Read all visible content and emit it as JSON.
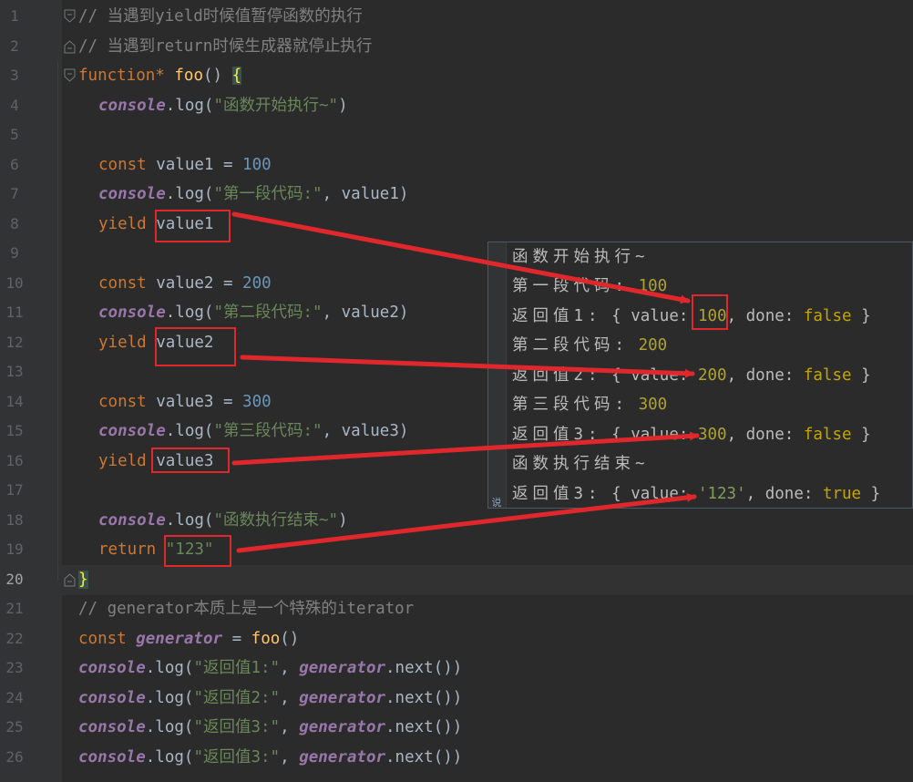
{
  "editor": {
    "current_line": 20,
    "line_numbers": [
      "1",
      "2",
      "3",
      "4",
      "5",
      "6",
      "7",
      "8",
      "9",
      "10",
      "11",
      "12",
      "13",
      "14",
      "15",
      "16",
      "17",
      "18",
      "19",
      "20",
      "21",
      "22",
      "23",
      "24",
      "25",
      "26"
    ],
    "lines": {
      "l1": "// 当遇到yield时候值暂停函数的执行",
      "l2": "// 当遇到return时候生成器就停止执行",
      "l3_kw": "function",
      "l3_star": "* ",
      "l3_fn": "foo",
      "l3_rest": "() ",
      "l3_brace": "{",
      "console": "console",
      "log_open": ".log(",
      "l4_str": "\"函数开始执行~\"",
      "close": ")",
      "const": "const ",
      "l6_var": "value1 = ",
      "l6_num": "100",
      "l7_str": "\"第一段代码:\"",
      "l7_rest": ", value1)",
      "yield": "yield ",
      "l8_val": "value1",
      "l10_var": "value2 = ",
      "l10_num": "200",
      "l11_str": "\"第二段代码:\"",
      "l11_rest": ", value2)",
      "l12_val": "value2",
      "l14_var": "value3 = ",
      "l14_num": "300",
      "l15_str": "\"第三段代码:\"",
      "l15_rest": ", value3)",
      "l16_val": "value3",
      "l18_str": "\"函数执行结束~\"",
      "return": "return ",
      "l19_str": "\"123\"",
      "l20_brace": "}",
      "l21": "// generator本质上是一个特殊的iterator",
      "l22_const": "const ",
      "l22_gen": "generator",
      "l22_eq": " = ",
      "l22_fn": "foo",
      "l22_rest": "()",
      "l23_str": "\"返回值1:\"",
      "l24_str": "\"返回值2:\"",
      "l25_str": "\"返回值3:\"",
      "l26_str": "\"返回值3:\"",
      "comma": ", ",
      "generator": "generator",
      "next": ".next())"
    }
  },
  "console_output": {
    "c1": "函数开始执行~",
    "c2_label": "第一段代码:",
    "c2_num": "100",
    "c3_label": "返回值1:",
    "c3_open": "{ value: ",
    "c3_val": "100",
    "c3_mid": ", done: ",
    "c3_done": "false",
    "c3_end": " }",
    "c4_label": "第二段代码:",
    "c4_num": "200",
    "c5_label": "返回值2:",
    "c5_open": "{ value: ",
    "c5_val": "200",
    "c5_mid": ", done: ",
    "c5_done": "false",
    "c5_end": " }",
    "c6_label": "第三段代码:",
    "c6_num": "300",
    "c7_label": "返回值3:",
    "c7_open": "{ value: ",
    "c7_val": "300",
    "c7_mid": ", done: ",
    "c7_done": "false",
    "c7_end": " }",
    "c8": "函数执行结束~",
    "c9_label": "返回值3:",
    "c9_open": "{ value: ",
    "c9_val": "'123'",
    "c9_mid": ", done: ",
    "c9_done": "true",
    "c9_end": " }",
    "side_icon": "说"
  },
  "colors": {
    "background": "#2b2b2b",
    "annotation_red": "#e0282c",
    "keyword": "#cc7832",
    "function": "#ffc66d",
    "string": "#6a8759",
    "number": "#6897bb"
  }
}
